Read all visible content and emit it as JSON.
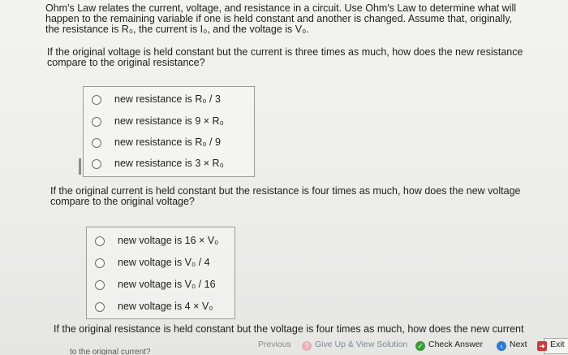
{
  "intro": {
    "line1": "Ohm's Law relates the current, voltage, and resistance in a circuit. Use Ohm's Law to determine what will",
    "line2": "happen to the remaining variable if one is held constant and another is changed. Assume that, originally,",
    "line3": "the resistance is R₀, the current is I₀, and the voltage is V₀."
  },
  "question1": {
    "line1": "If the original voltage is held constant but the current is three times as much, how does the new resistance",
    "line2": "compare to the original resistance?",
    "options": [
      "new resistance is R₀ / 3",
      "new resistance is 9 × R₀",
      "new resistance is R₀ / 9",
      "new resistance is 3 × R₀"
    ]
  },
  "question2": {
    "line1": "If the original current is held constant but the resistance is four times as much, how does the new voltage",
    "line2": "compare to the original voltage?",
    "options": [
      "new voltage is 16 × V₀",
      "new voltage is V₀ / 4",
      "new voltage is V₀ / 16",
      "new voltage is 4 × V₀"
    ]
  },
  "question3": {
    "line1": "If the original resistance is held constant but the voltage is four times as much, how does the new current",
    "line2_partial": "to the original current?"
  },
  "toolbar": {
    "previous_label": "Previous",
    "giveup_label": "Give Up & View Solution",
    "check_label": "Check Answer",
    "next_label": "Next",
    "exit_label": "Exit"
  }
}
